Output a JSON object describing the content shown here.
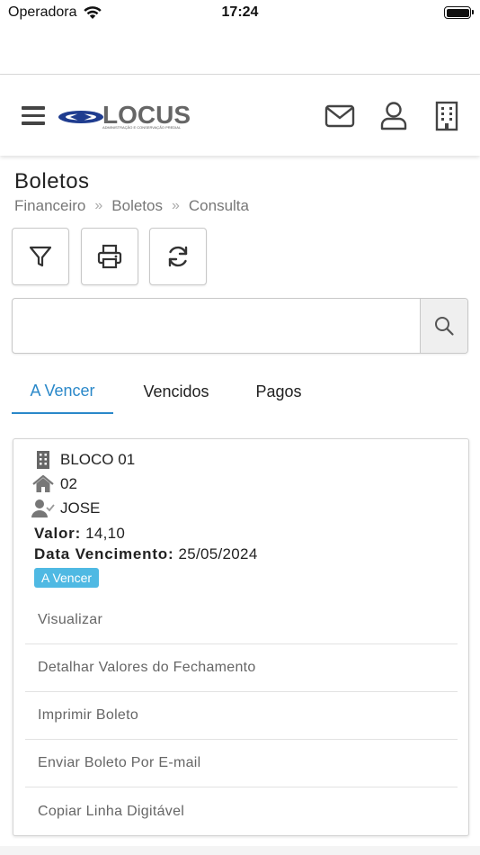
{
  "status_bar": {
    "carrier": "Operadora",
    "time": "17:24"
  },
  "header": {
    "logo_text": "LOCUS",
    "logo_subtitle": "ADMINISTRAÇÃO E CONSERVAÇÃO PREDIAL",
    "icons": [
      "menu-icon",
      "mail-icon",
      "user-icon",
      "building-icon"
    ]
  },
  "page": {
    "title": "Boletos",
    "breadcrumb": [
      "Financeiro",
      "Boletos",
      "Consulta"
    ]
  },
  "toolbar": {
    "icons": [
      "filter-icon",
      "print-icon",
      "refresh-icon"
    ]
  },
  "search": {
    "value": "",
    "placeholder": ""
  },
  "tabs": [
    {
      "label": "A Vencer",
      "active": true
    },
    {
      "label": "Vencidos",
      "active": false
    },
    {
      "label": "Pagos",
      "active": false
    }
  ],
  "card": {
    "bloco": "BLOCO 01",
    "unidade": "02",
    "pessoa": "JOSE",
    "valor_label": "Valor:",
    "valor": "14,10",
    "vencimento_label": "Data Vencimento:",
    "vencimento": "25/05/2024",
    "status_badge": "A Vencer",
    "status_color": "#4fb9e3",
    "actions": [
      "Visualizar",
      "Detalhar Valores do Fechamento",
      "Imprimir Boleto",
      "Enviar Boleto Por E-mail",
      "Copiar Linha Digitável"
    ]
  },
  "colors": {
    "accent": "#2a88c9",
    "logo_blue": "#1f3c8f"
  }
}
